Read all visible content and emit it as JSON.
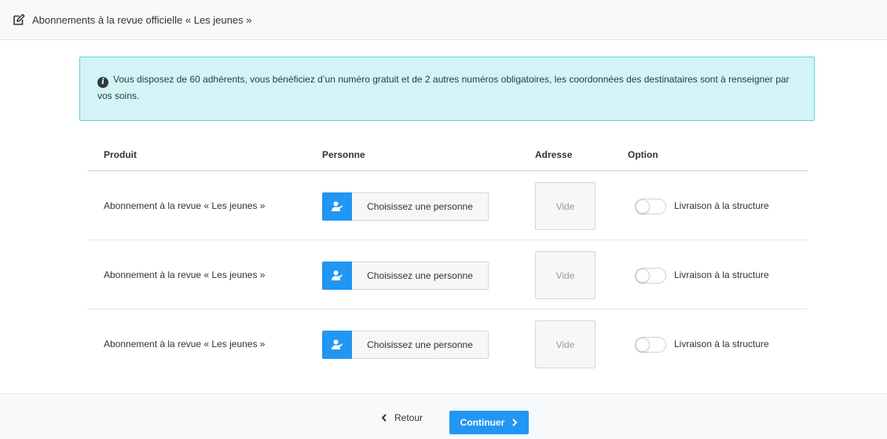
{
  "header": {
    "icon": "edit-icon",
    "title": "Abonnements à la revue officielle « Les jeunes »"
  },
  "info": {
    "icon": "info-circle-icon",
    "message": "Vous disposez de 60 adhérents, vous bénéficiez d’un numéro gratuit et de 2 autres numéros obligatoires, les coordonnées des destinataires sont à renseigner par vos soins."
  },
  "table": {
    "columns": {
      "product": "Produit",
      "person": "Personne",
      "address": "Adresse",
      "option": "Option"
    },
    "rows": [
      {
        "product": "Abonnement à la revue « Les jeunes »",
        "person_button": "Choisissez une personne",
        "address": "Vide",
        "option_label": "Livraison à la structure",
        "option_enabled": false
      },
      {
        "product": "Abonnement à la revue « Les jeunes »",
        "person_button": "Choisissez une personne",
        "address": "Vide",
        "option_label": "Livraison à la structure",
        "option_enabled": false
      },
      {
        "product": "Abonnement à la revue « Les jeunes »",
        "person_button": "Choisissez une personne",
        "address": "Vide",
        "option_label": "Livraison à la structure",
        "option_enabled": false
      }
    ]
  },
  "footer": {
    "back_label": "Retour",
    "continue_label": "Continuer"
  },
  "colors": {
    "primary": "#2196f3",
    "info_background": "#d4f3f6",
    "info_border": "#5fd3dc"
  }
}
